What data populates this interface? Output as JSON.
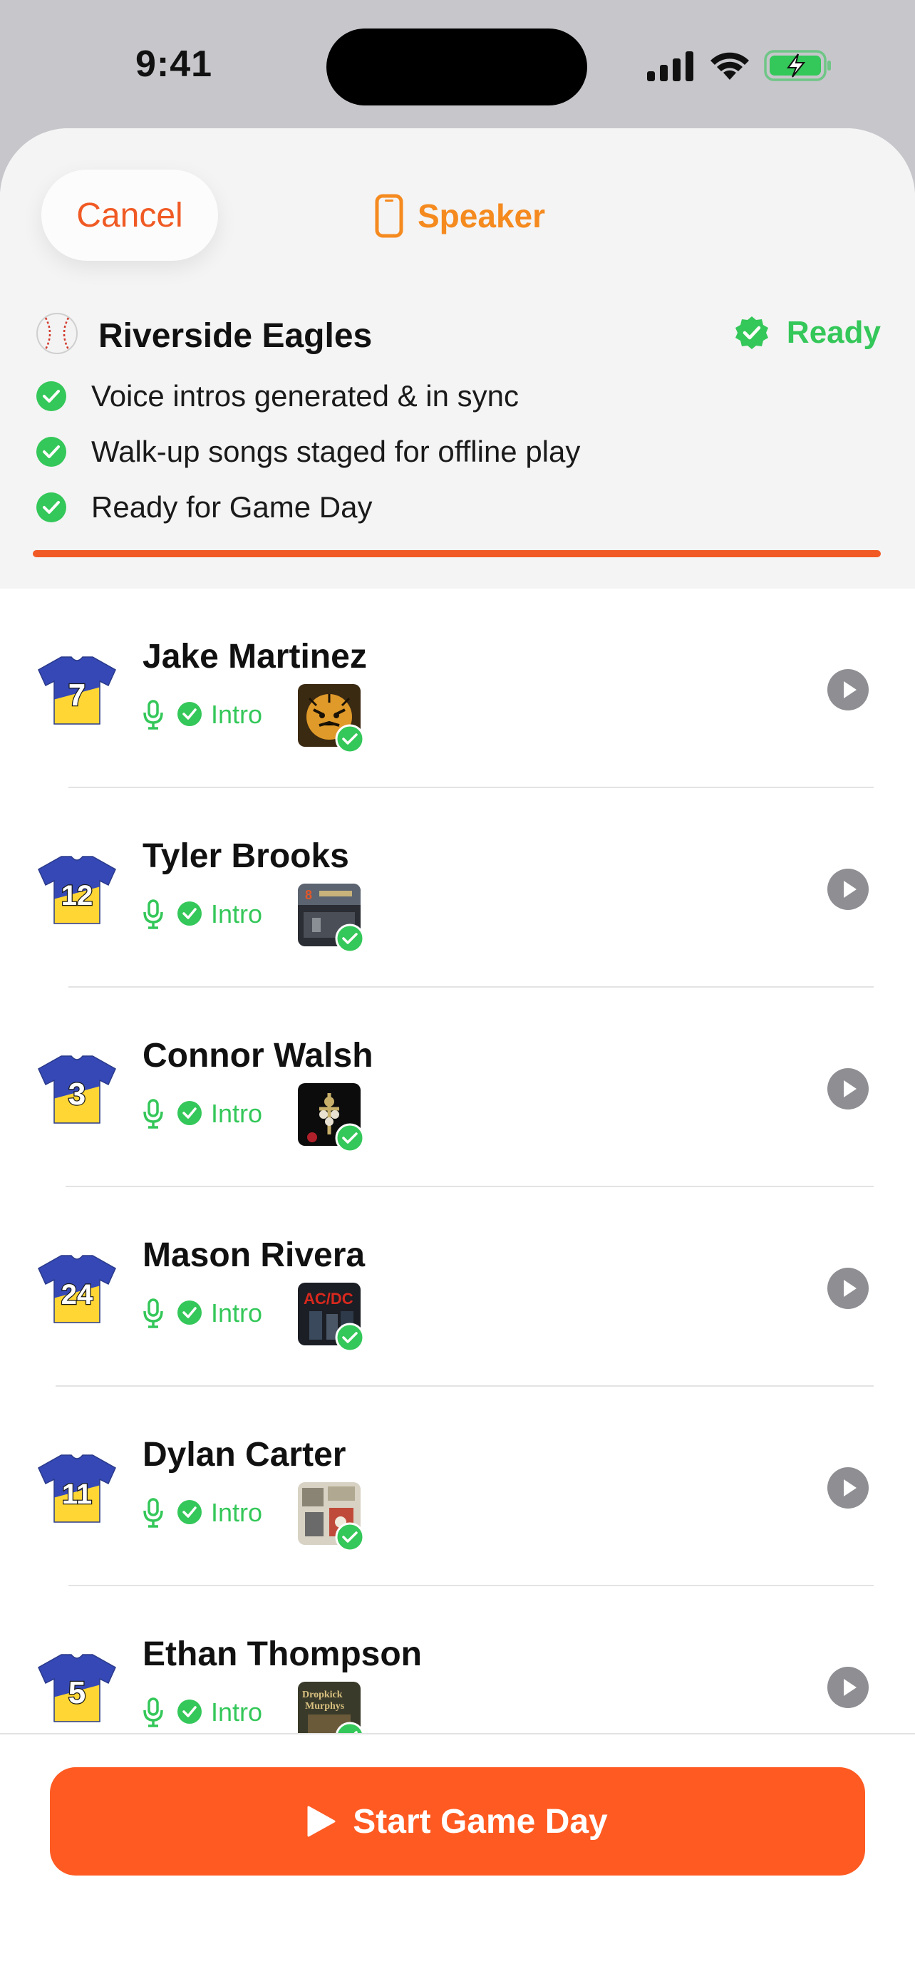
{
  "status_bar": {
    "time": "9:41"
  },
  "header": {
    "cancel_label": "Cancel",
    "speaker_label": "Speaker",
    "team_name": "Riverside Eagles",
    "ready_label": "Ready",
    "checklist": [
      "Voice intros generated & in sync",
      "Walk-up songs staged for offline play",
      "Ready for Game Day"
    ],
    "progress": 1.0
  },
  "players": [
    {
      "name": "Jake Martinez",
      "number": "7",
      "intro_label": "Intro",
      "art_icon": "tiger-album-art"
    },
    {
      "name": "Tyler Brooks",
      "number": "12",
      "intro_label": "Intro",
      "art_icon": "8-mile-album-art"
    },
    {
      "name": "Connor Walsh",
      "number": "3",
      "intro_label": "Intro",
      "art_icon": "guns-n-roses-album-art"
    },
    {
      "name": "Mason Rivera",
      "number": "24",
      "intro_label": "Intro",
      "art_icon": "acdc-album-art"
    },
    {
      "name": "Dylan Carter",
      "number": "11",
      "intro_label": "Intro",
      "art_icon": "collage-album-art"
    },
    {
      "name": "Ethan Thompson",
      "number": "5",
      "intro_label": "Intro",
      "art_icon": "dropkick-murphys-album-art"
    }
  ],
  "footer": {
    "start_label": "Start Game Day"
  },
  "colors": {
    "accent": "#fe5a22",
    "speaker": "#f58a1f",
    "success": "#34c759",
    "jersey_blue": "#3548b6",
    "jersey_yellow": "#ffd633"
  }
}
